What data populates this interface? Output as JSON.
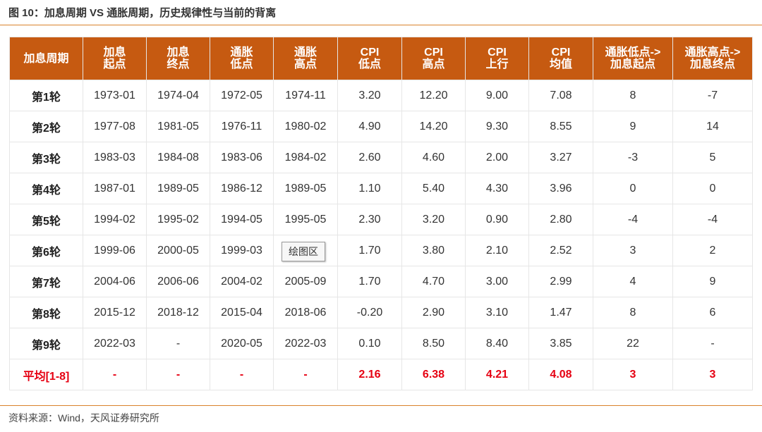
{
  "title": "图 10：加息周期 VS 通胀周期，历史规律性与当前的背离",
  "source": "资料来源：Wind，天风证券研究所",
  "overlay_tag": "绘图区",
  "colors": {
    "header_bg": "#c65a11",
    "rule": "#d9822b",
    "avg_text": "#e60012"
  },
  "table": {
    "headers": [
      [
        "加息周期"
      ],
      [
        "加息",
        "起点"
      ],
      [
        "加息",
        "终点"
      ],
      [
        "通胀",
        "低点"
      ],
      [
        "通胀",
        "高点"
      ],
      [
        "CPI",
        "低点"
      ],
      [
        "CPI",
        "高点"
      ],
      [
        "CPI",
        "上行"
      ],
      [
        "CPI",
        "均值"
      ],
      [
        "通胀低点->",
        "加息起点"
      ],
      [
        "通胀高点->",
        "加息终点"
      ]
    ],
    "rows": [
      [
        "第1轮",
        "1973-01",
        "1974-04",
        "1972-05",
        "1974-11",
        "3.20",
        "12.20",
        "9.00",
        "7.08",
        "8",
        "-7"
      ],
      [
        "第2轮",
        "1977-08",
        "1981-05",
        "1976-11",
        "1980-02",
        "4.90",
        "14.20",
        "9.30",
        "8.55",
        "9",
        "14"
      ],
      [
        "第3轮",
        "1983-03",
        "1984-08",
        "1983-06",
        "1984-02",
        "2.60",
        "4.60",
        "2.00",
        "3.27",
        "-3",
        "5"
      ],
      [
        "第4轮",
        "1987-01",
        "1989-05",
        "1986-12",
        "1989-05",
        "1.10",
        "5.40",
        "4.30",
        "3.96",
        "0",
        "0"
      ],
      [
        "第5轮",
        "1994-02",
        "1995-02",
        "1994-05",
        "1995-05",
        "2.30",
        "3.20",
        "0.90",
        "2.80",
        "-4",
        "-4"
      ],
      [
        "第6轮",
        "1999-06",
        "2000-05",
        "1999-03",
        "",
        "1.70",
        "3.80",
        "2.10",
        "2.52",
        "3",
        "2"
      ],
      [
        "第7轮",
        "2004-06",
        "2006-06",
        "2004-02",
        "2005-09",
        "1.70",
        "4.70",
        "3.00",
        "2.99",
        "4",
        "9"
      ],
      [
        "第8轮",
        "2015-12",
        "2018-12",
        "2015-04",
        "2018-06",
        "-0.20",
        "2.90",
        "3.10",
        "1.47",
        "8",
        "6"
      ],
      [
        "第9轮",
        "2022-03",
        "-",
        "2020-05",
        "2022-03",
        "0.10",
        "8.50",
        "8.40",
        "3.85",
        "22",
        "-"
      ]
    ],
    "average_row": [
      "平均[1-8]",
      "-",
      "-",
      "-",
      "-",
      "2.16",
      "6.38",
      "4.21",
      "4.08",
      "3",
      "3"
    ]
  }
}
